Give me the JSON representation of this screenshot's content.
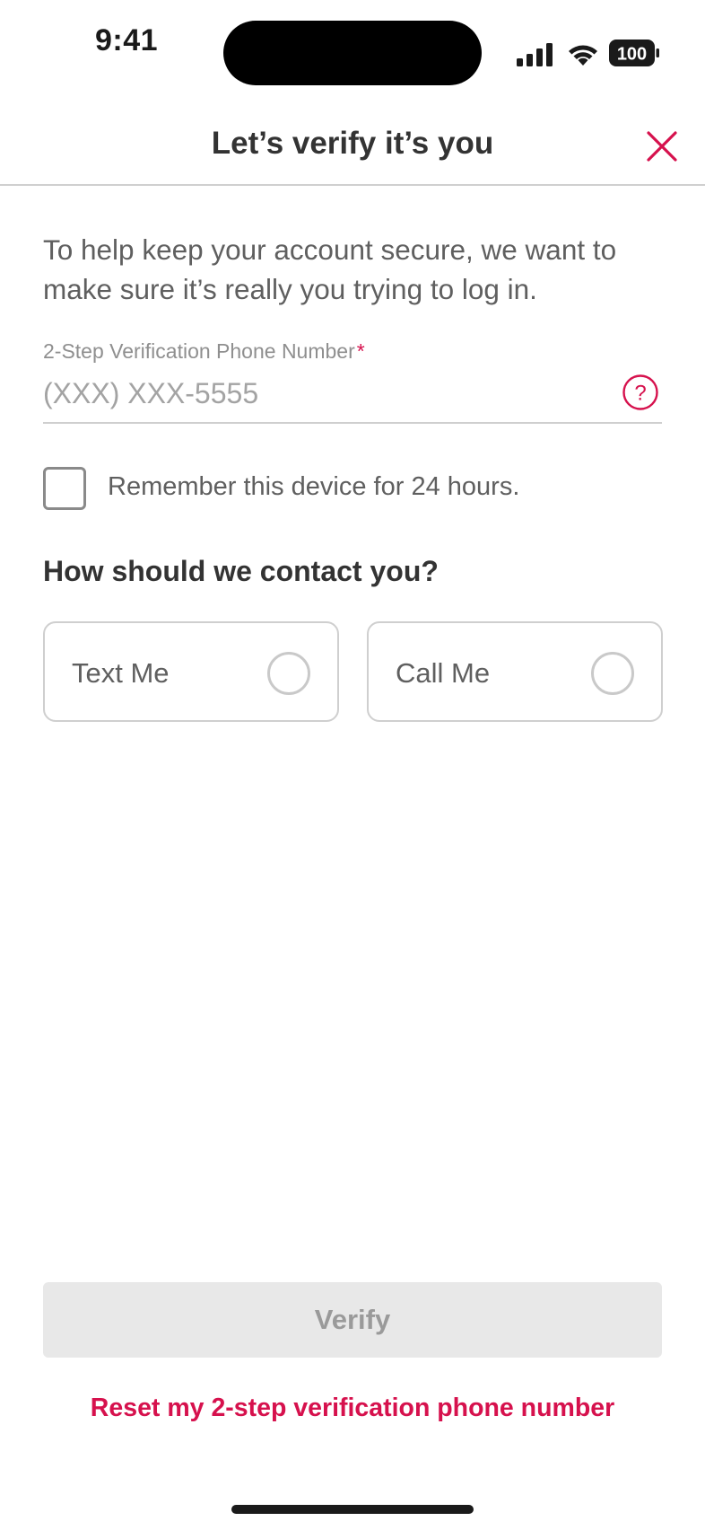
{
  "status_bar": {
    "time": "9:41",
    "battery": "100"
  },
  "header": {
    "title": "Let’s verify it’s you",
    "close_icon": "close-icon"
  },
  "intro_text": "To help keep your account secure, we want to make sure it’s really you trying to log in.",
  "phone_field": {
    "label": "2-Step Verification Phone Number",
    "required_marker": "*",
    "placeholder": "(XXX) XXX-5555",
    "value": "",
    "help_icon": "question-circle-icon"
  },
  "remember_device": {
    "label": "Remember this device for 24 hours.",
    "checked": false
  },
  "contact": {
    "heading": "How should we contact you?",
    "options": [
      {
        "label": "Text Me",
        "selected": false
      },
      {
        "label": "Call Me",
        "selected": false
      }
    ]
  },
  "actions": {
    "verify_label": "Verify",
    "reset_link": "Reset my 2-step verification phone number"
  },
  "colors": {
    "accent": "#d6114d",
    "disabled_button": "#e8e8e8",
    "text": "#3b3b3b"
  }
}
